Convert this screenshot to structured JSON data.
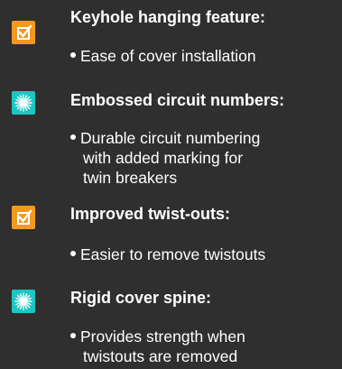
{
  "features": [
    {
      "icon": "checkbox-icon",
      "color": "#f39a1e",
      "title": "Keyhole hanging feature:",
      "lines": [
        "Ease of cover installation"
      ]
    },
    {
      "icon": "starburst-icon",
      "color": "#1cc6c3",
      "title": "Embossed circuit numbers:",
      "lines": [
        "Durable circuit numbering",
        "with added marking for",
        "twin breakers"
      ]
    },
    {
      "icon": "checkbox-icon",
      "color": "#f39a1e",
      "title": "Improved twist-outs:",
      "lines": [
        "Easier to remove twistouts"
      ]
    },
    {
      "icon": "starburst-icon",
      "color": "#1cc6c3",
      "title": "Rigid cover spine:",
      "lines": [
        "Provides strength when",
        "twistouts are removed"
      ]
    }
  ]
}
